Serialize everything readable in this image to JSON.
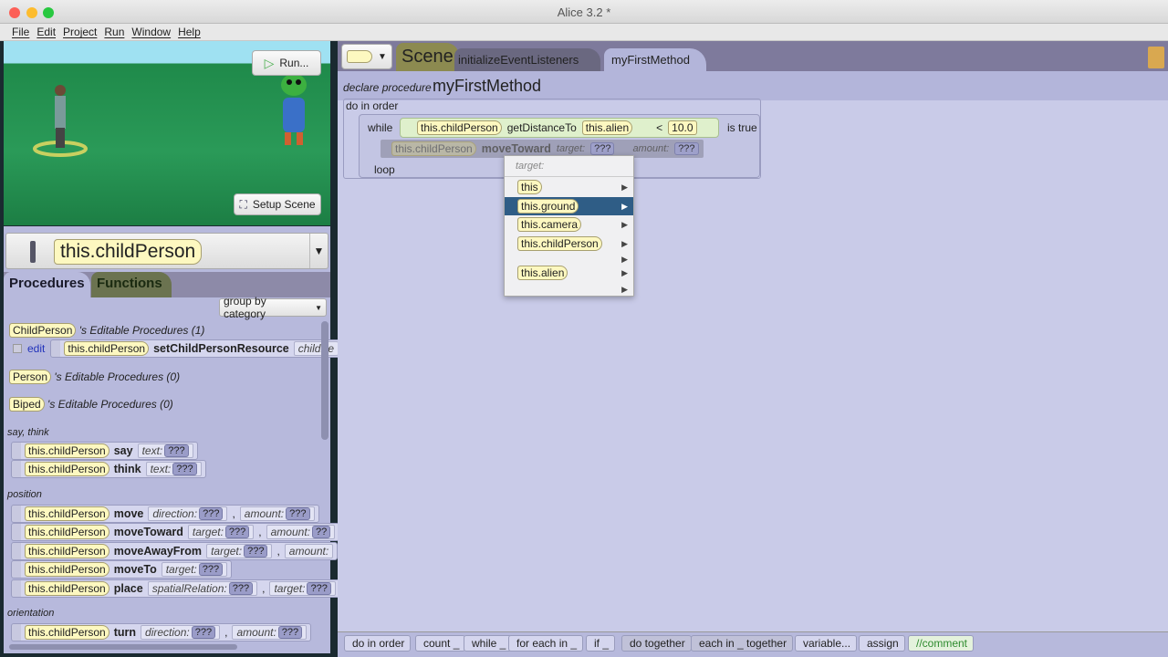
{
  "window": {
    "title": "Alice 3.2 *"
  },
  "menu": [
    "File",
    "Edit",
    "Project",
    "Run",
    "Window",
    "Help"
  ],
  "scene": {
    "run_label": "Run...",
    "setup_label": "Setup Scene"
  },
  "selector": {
    "value": "this.childPerson"
  },
  "left_tabs": [
    "Procedures",
    "Functions"
  ],
  "group_by": "group by category",
  "editable": [
    {
      "class": "ChildPerson",
      "label": "'s Editable Procedures (1)"
    },
    {
      "class": "Person",
      "label": "'s Editable Procedures (0)"
    },
    {
      "class": "Biped",
      "label": "'s Editable Procedures (0)"
    }
  ],
  "edit_row": {
    "edit": "edit",
    "target": "this.childPerson",
    "method": "setChildPersonResource",
    "param": "childPe"
  },
  "categories": {
    "say": "say, think",
    "position": "position",
    "orientation": "orientation"
  },
  "procs": [
    {
      "target": "this.childPerson",
      "method": "say",
      "p1": "text:",
      "v1": "???"
    },
    {
      "target": "this.childPerson",
      "method": "think",
      "p1": "text:",
      "v1": "???"
    },
    {
      "target": "this.childPerson",
      "method": "move",
      "p1": "direction:",
      "v1": "???",
      "p2": "amount:",
      "v2": "???"
    },
    {
      "target": "this.childPerson",
      "method": "moveToward",
      "p1": "target:",
      "v1": "???",
      "p2": "amount:",
      "v2": "??"
    },
    {
      "target": "this.childPerson",
      "method": "moveAwayFrom",
      "p1": "target:",
      "v1": "???",
      "p2": "amount:"
    },
    {
      "target": "this.childPerson",
      "method": "moveTo",
      "p1": "target:",
      "v1": "???"
    },
    {
      "target": "this.childPerson",
      "method": "place",
      "p1": "spatialRelation:",
      "v1": "???",
      "p2": "target:",
      "v2": "???"
    },
    {
      "target": "this.childPerson",
      "method": "turn",
      "p1": "direction:",
      "v1": "???",
      "p2": "amount:",
      "v2": "???"
    }
  ],
  "right_tabs": [
    "Scene",
    "initializeEventListeners",
    "myFirstMethod"
  ],
  "code": {
    "declare": "declare procedure",
    "method": "myFirstMethod",
    "do_in_order": "do in order",
    "while": "while",
    "obj": "this.childPerson",
    "func": "getDistanceTo",
    "arg": "this.alien",
    "op": "<",
    "num": "10.0",
    "is_true": "is true",
    "drag_target": "this.childPerson",
    "drag_method": "moveToward",
    "drag_p1": "target:",
    "drag_v1": "???",
    "drag_p2": "amount:",
    "drag_v2": "???",
    "loop": "loop"
  },
  "popup": {
    "header": "target:",
    "items": [
      "this",
      "this.ground",
      "this.camera",
      "this.childPerson",
      "",
      "this.alien",
      ""
    ]
  },
  "bottom": [
    "do in order",
    "count _",
    "while _",
    "for each in _",
    "if _",
    "do together",
    "each in _ together",
    "variable...",
    "assign",
    "//comment"
  ],
  "colors": {
    "tile": "#fdf8c0",
    "highlight": "#2f5d86",
    "comment": "#2e8b2e"
  }
}
